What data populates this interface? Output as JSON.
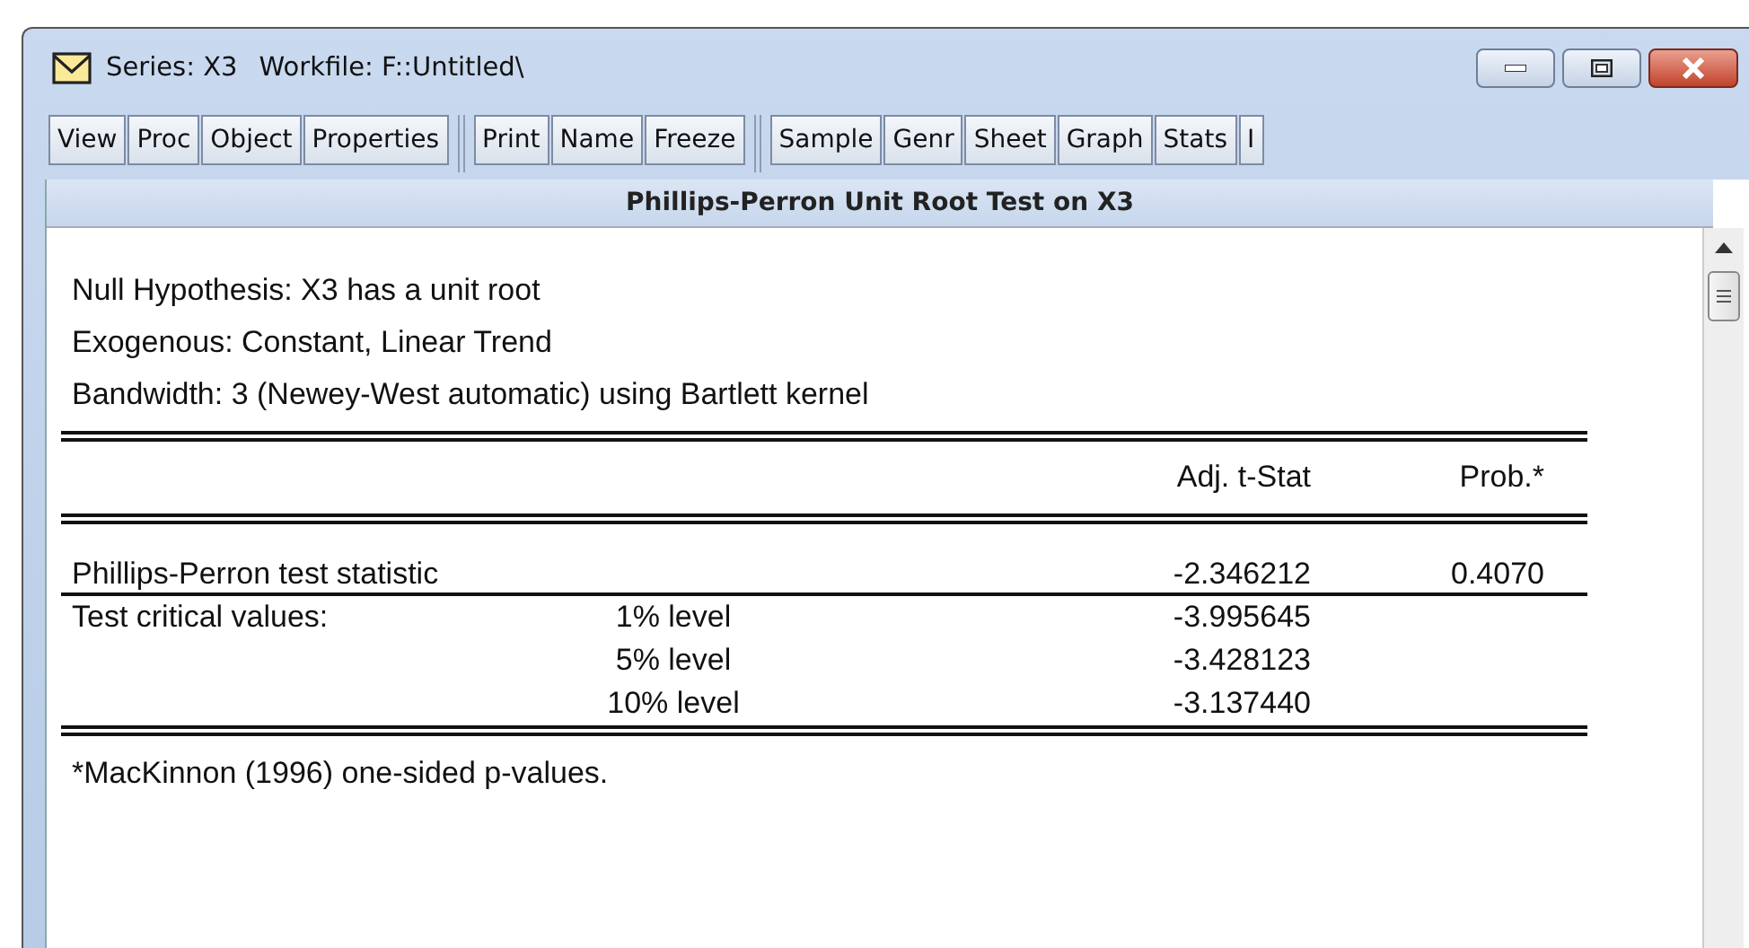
{
  "window": {
    "title_parts": [
      "Series: X3",
      "Workfile: F::Untitled\\"
    ]
  },
  "toolbar": {
    "groups": [
      [
        "View",
        "Proc",
        "Object",
        "Properties"
      ],
      [
        "Print",
        "Name",
        "Freeze"
      ],
      [
        "Sample",
        "Genr",
        "Sheet",
        "Graph",
        "Stats",
        "I"
      ]
    ]
  },
  "header": "Phillips-Perron Unit Root Test on X3",
  "output": {
    "lines": [
      "Null Hypothesis: X3 has a unit root",
      "Exogenous: Constant, Linear Trend",
      "Bandwidth: 3 (Newey-West automatic) using Bartlett kernel"
    ],
    "columns": [
      "Adj. t-Stat",
      "Prob.*"
    ],
    "rows": [
      {
        "label": "Phillips-Perron test statistic",
        "level": "",
        "stat": "-2.346212",
        "prob": "0.4070"
      },
      {
        "label": "Test critical values:",
        "level": "1% level",
        "stat": "-3.995645",
        "prob": ""
      },
      {
        "label": "",
        "level": "5% level",
        "stat": "-3.428123",
        "prob": ""
      },
      {
        "label": "",
        "level": "10% level",
        "stat": "-3.137440",
        "prob": ""
      }
    ],
    "footnote": "*MacKinnon (1996) one-sided p-values."
  }
}
